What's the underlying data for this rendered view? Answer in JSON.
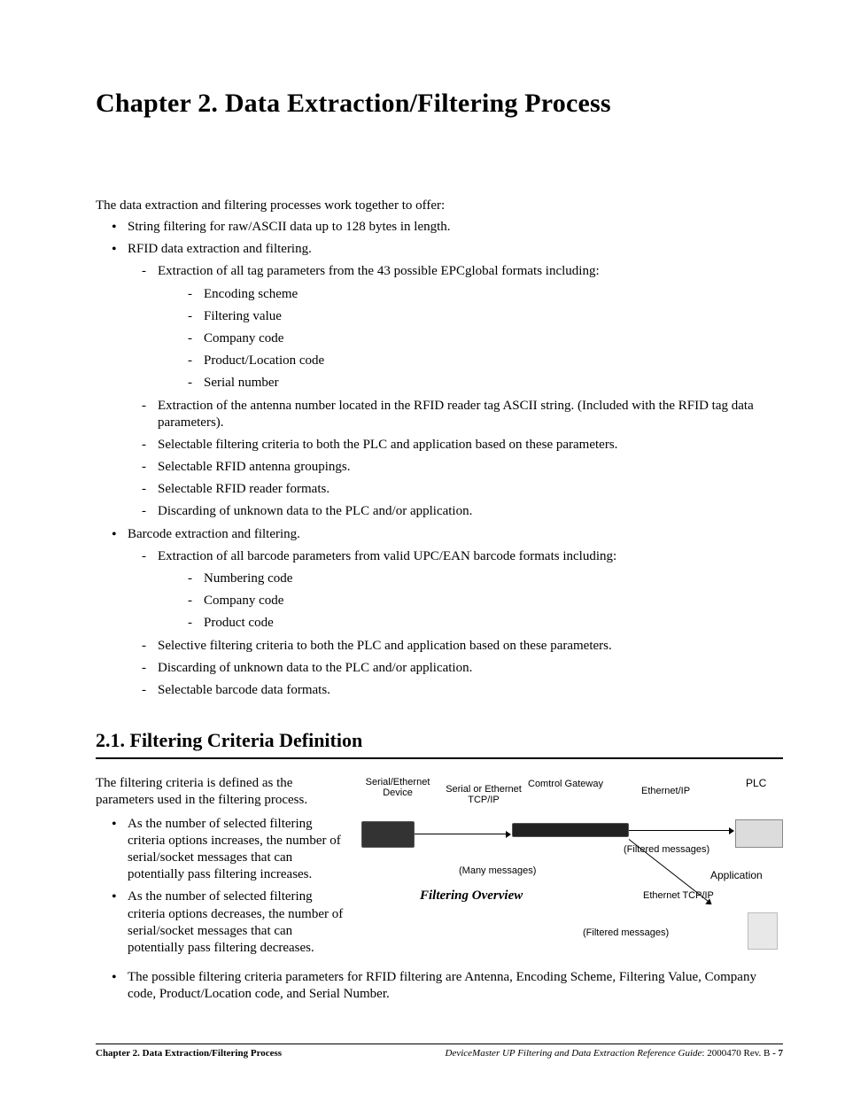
{
  "chapter_title": "Chapter 2.  Data Extraction/Filtering Process",
  "intro": "The data extraction and filtering processes work together to offer:",
  "bullets": [
    "String filtering for raw/ASCII data up to 128 bytes in length.",
    "RFID data extraction and filtering.",
    "Barcode extraction and filtering."
  ],
  "rfid_sub": [
    "Extraction of all tag parameters from the 43 possible EPCglobal formats including:",
    "Extraction of the antenna number located in the RFID reader tag ASCII string. (Included with the RFID tag data parameters).",
    "Selectable filtering criteria to both the PLC and application based on these parameters.",
    "Selectable RFID antenna groupings.",
    "Selectable RFID reader formats.",
    "Discarding of unknown data to the PLC and/or application."
  ],
  "rfid_params": [
    "Encoding scheme",
    "Filtering value",
    "Company code",
    "Product/Location code",
    "Serial number"
  ],
  "barcode_sub": [
    "Extraction of all barcode parameters from valid UPC/EAN barcode formats including:",
    "Selective filtering criteria to both the PLC and application based on these parameters.",
    "Discarding of unknown data to the PLC and/or application.",
    "Selectable barcode data formats."
  ],
  "barcode_params": [
    "Numbering code",
    "Company code",
    "Product code"
  ],
  "section_title": "2.1.   Filtering Criteria Definition",
  "section_intro": "The filtering criteria is defined as the parameters used in the filtering process.",
  "section_bullets": [
    "As the number of selected filtering criteria options increases, the number of serial/socket messages that can potentially pass filtering increases.",
    "As the number of selected filtering criteria options decreases, the number of serial/socket messages that can potentially pass filtering decreases.",
    "The possible filtering criteria parameters for RFID filtering are Antenna, Encoding Scheme, Filtering Value, Company code, Product/Location code, and Serial Number."
  ],
  "diagram": {
    "serial_eth_device": "Serial/Ethernet\nDevice",
    "serial_or_eth_tcpip": "Serial or Ethernet\nTCP/IP",
    "comtrol_gateway": "Comtrol Gateway",
    "ethernet_ip": "Ethernet/IP",
    "plc": "PLC",
    "filtered_messages": "(Filtered messages)",
    "many_messages": "(Many messages)",
    "application": "Application",
    "ethernet_tcpip": "Ethernet TCP/IP",
    "overview": "Filtering Overview"
  },
  "footer": {
    "left": "Chapter 2. Data Extraction/Filtering Process",
    "right_italic": "DeviceMaster UP Filtering and Data Extraction Reference Guide",
    "right_plain": ": 2000470 Rev. B ",
    "page": "- 7"
  }
}
